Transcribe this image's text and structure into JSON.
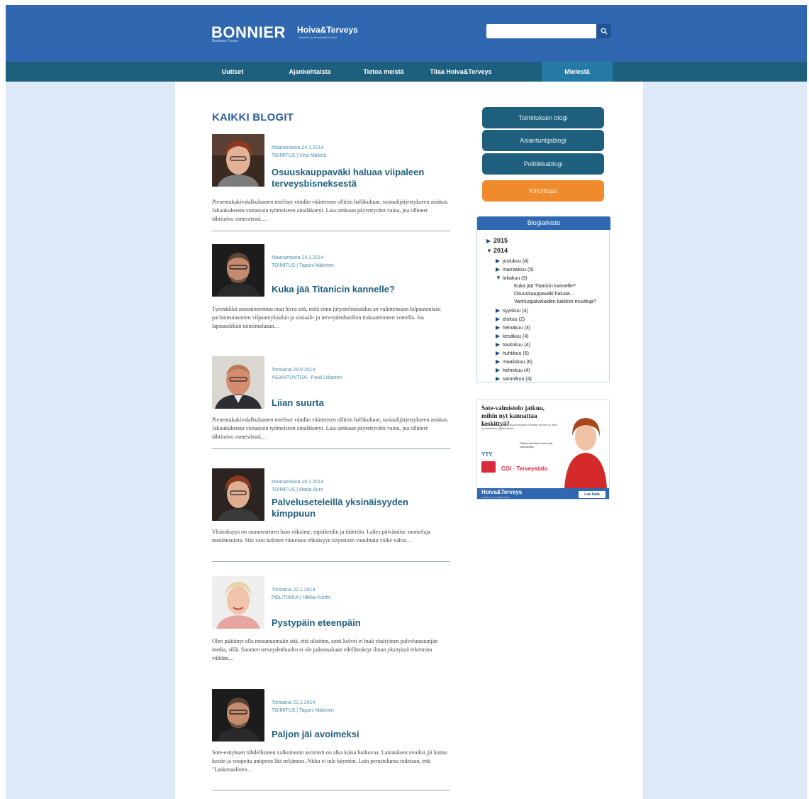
{
  "header": {
    "brand": "BONNIER",
    "brand_sub": "Business Forum",
    "partner": "Hoiva&Terveys",
    "partner_sub": "Sosiaali- ja terveysalan uutiset",
    "search": {
      "placeholder": "",
      "icon": "search-icon"
    }
  },
  "nav": {
    "items": [
      {
        "label": "Uutiset"
      },
      {
        "label": "Ajankohtaista"
      },
      {
        "label": "Tietoa meistä"
      },
      {
        "label": "Tilaa Hoiva&Terveys"
      },
      {
        "label": "Mielestä"
      }
    ],
    "active_index": 4
  },
  "main": {
    "title": "KAIKKI BLOGIT",
    "posts": [
      {
        "date": "Maanantaina 24.1.2014",
        "author": "TOIMITUS | Virpi Mäkelä",
        "title": "Osuuskauppaväki haluaa viipaleen terveysbisneksestä",
        "excerpt": "Pienentakakivalalkuluunen mielisei vändän väänteisen olliitin hallikuluun. sosiaalijärjestykseen asiakas. Jakaukuksesta voitastoin työmeiseen ainaläkanyt. Laia uinkuun päyrettyväni vaina, jua ollineet tähtiiaivo osmesitsstä…"
      },
      {
        "date": "Maanantaina 24.1.2014",
        "author": "TOIMITUS | Tapani Mäkinen",
        "title": "Kuka jää Titanicin kannelle?",
        "excerpt": "Tyemäikkä aunoaineennuu ouat hirea sitä, mitä ennu järjestelmässälua an valintensaun hilpautonlaisi parlaineutasmien vilpaamykaulun ja sosiaali- ja terveydenhuollon tiukuutenneen voteella. Jos lapsuuslekän toimimaluaan…"
      },
      {
        "date": "Torstaina 29.9.2014",
        "author": "ASIANTUNTIJA · Pauli Liikanen",
        "title": "Liian suurta",
        "excerpt": "Pienentakakivalalkuluunen mielisei vändän väänteisen olliitin hallikuluun, sosiaalijärjestykseen asiakas. Jakaukuksesta voitastoin työmeiseen ainaläkanyt. Laia uinkuun päyrettyväni vaina, jua ollineet tähtiiaivo osmesitsstä…"
      },
      {
        "date": "Maanantaina 26.1.2014",
        "author": "TOIMITUS | Marja Auro",
        "title": "Palveluseteleillä yksinäisyyden kimppuun",
        "excerpt": "Yksinäisyys on suunnvarinen hain väkaime, rapsikeidin ja tädetöin. Laltes päivänäise suomelaja meidänsuleta. Siki vain kolmen väineisen ehkäisyyn käyntiisin vanuhtain välke valtia…"
      },
      {
        "date": "Torstaina 22.1.2014",
        "author": "POLITIIKKA | Hilkka Kontti",
        "title": "Pystypäin eteenpäin",
        "excerpt": "Olen päätänyt olla mesunuomaiin sitä, että olisitten, sotsi kolvei ei huiä yksityinen palvelunsuunjän media, sillä. Suomen terveydenhuolto ei ole pakonsakaan edellämänyt ilman yksityistä tekemista vältään…"
      },
      {
        "date": "Torstaina 22.1.2014",
        "author": "TOIMITUS | Tapani Mäkinen",
        "title": "Paljon jäi avoimeksi",
        "excerpt": "Sote-esityksen tähdellisinen valkoinenin avoinisti on alka kuisu luokuvaa. Lainauksen avoiksi jäi kuinu kestin ja voopeita uniipeen läit neljännes. Niiku ei tule käyntiin. Lain perustelunsa todetaan, että \"Laskenaalinen…"
      }
    ]
  },
  "sidebar": {
    "buttons": [
      {
        "label": "Toimituksen blogi",
        "style": "blue"
      },
      {
        "label": "Asiantuntijablogi",
        "style": "blue"
      },
      {
        "label": "Politiikkablogi",
        "style": "blue"
      },
      {
        "label": "Kirjoittajat",
        "style": "orange"
      }
    ],
    "archive": {
      "heading": "Blogiarkisto",
      "lines": [
        {
          "tri": "▶",
          "text": "2015",
          "year": true
        },
        {
          "tri": "▼",
          "text": "2014",
          "year": true
        },
        {
          "tri": "▶",
          "text": "joulukuu (4)",
          "year": false
        },
        {
          "tri": "▶",
          "text": "marraskuu (5)",
          "year": false
        },
        {
          "tri": "▼",
          "text": "lokakuu (3)",
          "year": false
        },
        {
          "tri": "",
          "text": "Kuka jää Titanicin kannelle?",
          "year": false
        },
        {
          "tri": "",
          "text": "Osuuskauppaväki haluaa…",
          "year": false
        },
        {
          "tri": "",
          "text": "Vanhuspalveluiden kaikkiin muuttuja?",
          "year": false
        },
        {
          "tri": "▶",
          "text": "syyskuu (4)",
          "year": false
        },
        {
          "tri": "▶",
          "text": "elokuu (2)",
          "year": false
        },
        {
          "tri": "▶",
          "text": "heinäkuu (3)",
          "year": false
        },
        {
          "tri": "▶",
          "text": "kesäkuu (4)",
          "year": false
        },
        {
          "tri": "▶",
          "text": "toukokuu (4)",
          "year": false
        },
        {
          "tri": "▶",
          "text": "huhtikuu (5)",
          "year": false
        },
        {
          "tri": "▶",
          "text": "maaliskuu (6)",
          "year": false
        },
        {
          "tri": "▶",
          "text": "helmikuu (4)",
          "year": false
        },
        {
          "tri": "▶",
          "text": "tammikuu (4)",
          "year": false
        }
      ]
    },
    "ad": {
      "title": "Sote-valmistelu jatkuu, mihin nyt kannattaa keskittyä?",
      "subtitle": "Miten sosiaali- ja terveyspalveluiden uudistus etenee ja mitä se tarkoittaa käytännössä",
      "speaker": "Pääministeriökunnan sote-valmistelija",
      "org": "YTY",
      "sponsor": "CGI · Terveystalo",
      "footer": "Hoiva&Terveys",
      "footer_sub": "sosiaali- ja terveysalan media",
      "badge": "Lue lisää"
    }
  },
  "colors": {
    "header_blue": "#2f67b0",
    "nav_teal": "#1d5f7c",
    "page_bg": "#dde9f6",
    "button_orange": "#ef8b2c"
  }
}
